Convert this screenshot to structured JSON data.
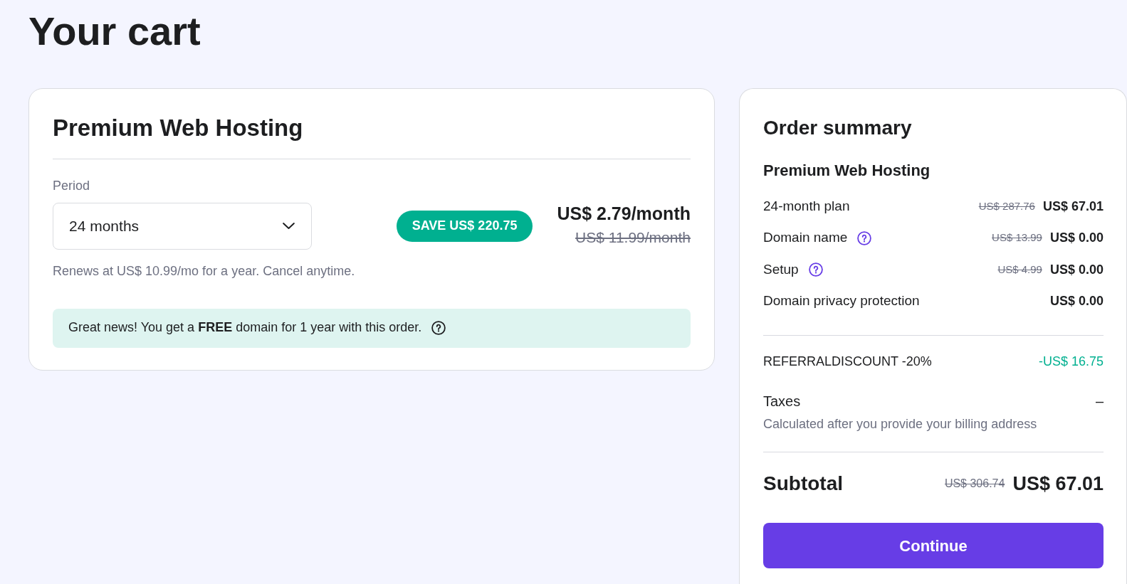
{
  "page": {
    "title": "Your cart"
  },
  "product_card": {
    "title": "Premium Web Hosting",
    "period": {
      "label": "Period",
      "value": "24 months"
    },
    "save_badge": "SAVE US$ 220.75",
    "price": "US$ 2.79/month",
    "old_price": "US$ 11.99/month",
    "renewal_note": "Renews at US$ 10.99/mo for a year. Cancel anytime.",
    "notice": "Great news! You get a **FREE** domain for 1 year with this order."
  },
  "order_summary": {
    "title": "Order summary",
    "product": "Premium Web Hosting",
    "lines": [
      {
        "label": "24-month plan",
        "help": false,
        "old_price": "US$ 287.76",
        "price": "US$ 67.01"
      },
      {
        "label": "Domain name",
        "help": true,
        "old_price": "US$ 13.99",
        "price": "US$ 0.00"
      },
      {
        "label": "Setup",
        "help": true,
        "old_price": "US$ 4.99",
        "price": "US$ 0.00"
      },
      {
        "label": "Domain privacy protection",
        "help": false,
        "price": "US$ 0.00"
      }
    ],
    "discount": {
      "label": "REFERRALDISCOUNT -20%",
      "amount": "-US$ 16.75"
    },
    "taxes": {
      "label": "Taxes",
      "value": "–",
      "note": "Calculated after you provide your billing address"
    },
    "subtotal": {
      "label": "Subtotal",
      "old_price": "US$ 306.74",
      "price": "US$ 67.01"
    },
    "continue_button": "Continue"
  }
}
